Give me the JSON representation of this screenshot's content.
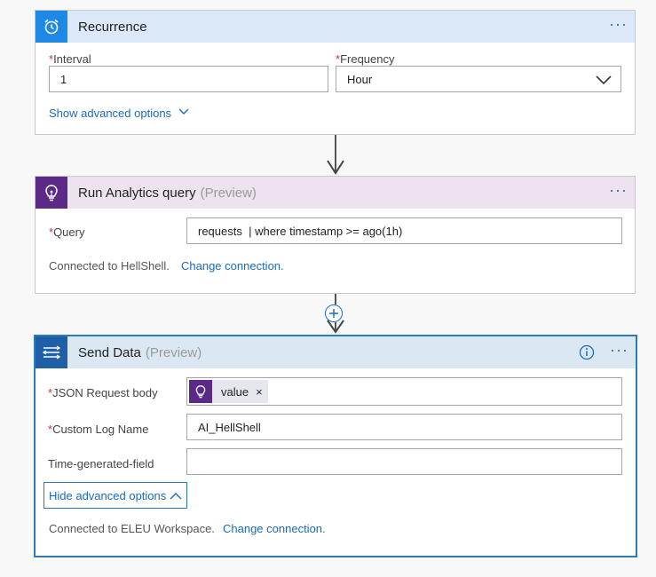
{
  "recurrence": {
    "title": "Recurrence",
    "more": "···",
    "interval_label": "Interval",
    "interval_value": "1",
    "frequency_label": "Frequency",
    "frequency_value": "Hour",
    "advanced_link": "Show advanced options",
    "accent": "#1e88e5"
  },
  "analytics": {
    "title": "Run Analytics query",
    "preview": "(Preview)",
    "more": "···",
    "query_label": "Query",
    "query_value": "requests  | where timestamp >= ago(1h)",
    "connected_text": "Connected to HellShell.",
    "change_link": "Change connection.",
    "accent": "#5b2a86",
    "header_bg": "#ece3ef"
  },
  "senddata": {
    "title": "Send Data",
    "preview": "(Preview)",
    "more": "···",
    "json_label": "JSON Request body",
    "json_token": "value",
    "json_token_remove": "×",
    "logname_label": "Custom Log Name",
    "logname_value": "AI_HellShell",
    "timefield_label": "Time-generated-field",
    "timefield_value": "",
    "advanced_button": "Hide advanced options",
    "connected_text": "Connected to ELEU Workspace.",
    "change_link": "Change connection.",
    "accent": "#1e5fa8",
    "header_bg": "#dbe8f4"
  },
  "required_marker": "*"
}
